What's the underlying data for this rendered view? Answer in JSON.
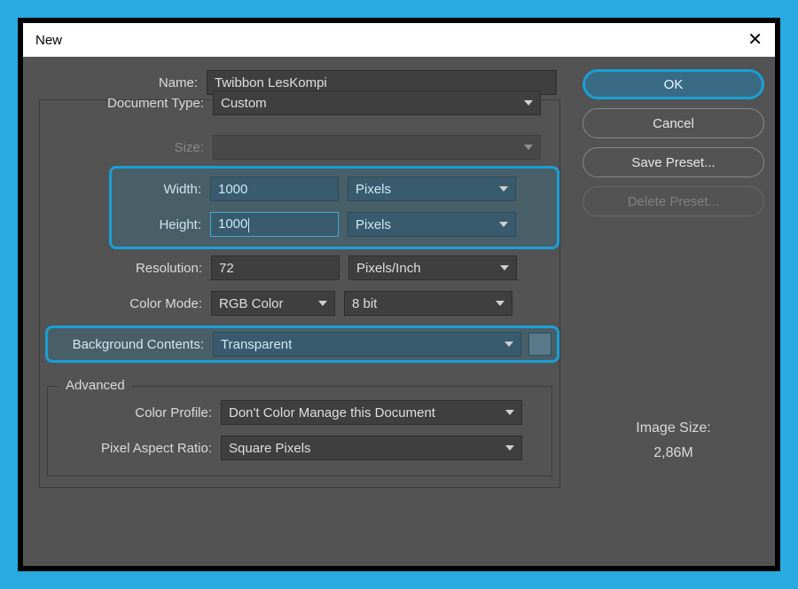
{
  "window": {
    "title": "New"
  },
  "form": {
    "name_label": "Name:",
    "name_value": "Twibbon LesKompi",
    "doc_type_label": "Document Type:",
    "doc_type_value": "Custom",
    "size_label": "Size:",
    "size_value": "",
    "width_label": "Width:",
    "width_value": "1000",
    "width_unit": "Pixels",
    "height_label": "Height:",
    "height_value": "1000",
    "height_unit": "Pixels",
    "resolution_label": "Resolution:",
    "resolution_value": "72",
    "resolution_unit": "Pixels/Inch",
    "color_mode_label": "Color Mode:",
    "color_mode_value": "RGB Color",
    "color_depth_value": "8 bit",
    "bg_label": "Background Contents:",
    "bg_value": "Transparent"
  },
  "advanced": {
    "legend": "Advanced",
    "profile_label": "Color Profile:",
    "profile_value": "Don't Color Manage this Document",
    "par_label": "Pixel Aspect Ratio:",
    "par_value": "Square Pixels"
  },
  "buttons": {
    "ok": "OK",
    "cancel": "Cancel",
    "save_preset": "Save Preset...",
    "delete_preset": "Delete Preset..."
  },
  "image_size": {
    "label": "Image Size:",
    "value": "2,86M"
  }
}
